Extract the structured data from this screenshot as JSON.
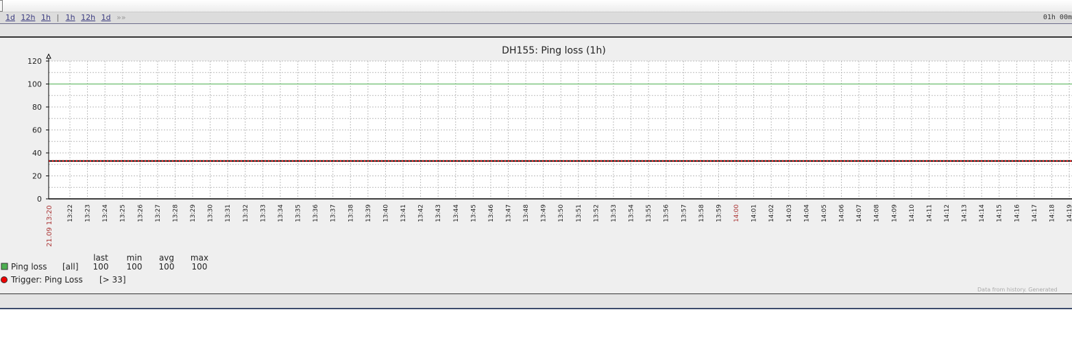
{
  "nav": {
    "links_left": [
      "1d",
      "12h",
      "1h"
    ],
    "links_right": [
      "1h",
      "12h",
      "1d"
    ],
    "separator": "|",
    "more": "»»",
    "period": "01h 00m"
  },
  "chart_data": {
    "type": "line",
    "title": "DH155: Ping loss  (1h)",
    "ylim": [
      0,
      120
    ],
    "yticks": [
      0,
      20,
      40,
      60,
      80,
      100,
      120
    ],
    "x_start_label": "21.09 13:20",
    "x_labels": [
      "13:22",
      "13:23",
      "13:24",
      "13:25",
      "13:26",
      "13:27",
      "13:28",
      "13:29",
      "13:30",
      "13:31",
      "13:32",
      "13:33",
      "13:34",
      "13:35",
      "13:36",
      "13:37",
      "13:38",
      "13:39",
      "13:40",
      "13:41",
      "13:42",
      "13:43",
      "13:44",
      "13:45",
      "13:46",
      "13:47",
      "13:48",
      "13:49",
      "13:50",
      "13:51",
      "13:52",
      "13:53",
      "13:54",
      "13:55",
      "13:56",
      "13:57",
      "13:58",
      "13:59",
      "14:00",
      "14:01",
      "14:02",
      "14:03",
      "14:04",
      "14:05",
      "14:06",
      "14:07",
      "14:08",
      "14:09",
      "14:10",
      "14:11",
      "14:12",
      "14:13",
      "14:14",
      "14:15",
      "14:16",
      "14:17",
      "14:18",
      "14:19"
    ],
    "highlight_label": "14:00",
    "series": [
      {
        "name": "Ping loss",
        "scope": "[all]",
        "color": "#4caf50",
        "value": 100,
        "last": "100",
        "min": "100",
        "avg": "100",
        "max": "100"
      }
    ],
    "trigger": {
      "name": "Trigger: Ping Loss",
      "condition": "[> 33]",
      "value": 33,
      "color": "#ee0000"
    },
    "legend_headers": [
      "last",
      "min",
      "avg",
      "max"
    ],
    "grid": true,
    "footer": "Data from history. Generated"
  }
}
